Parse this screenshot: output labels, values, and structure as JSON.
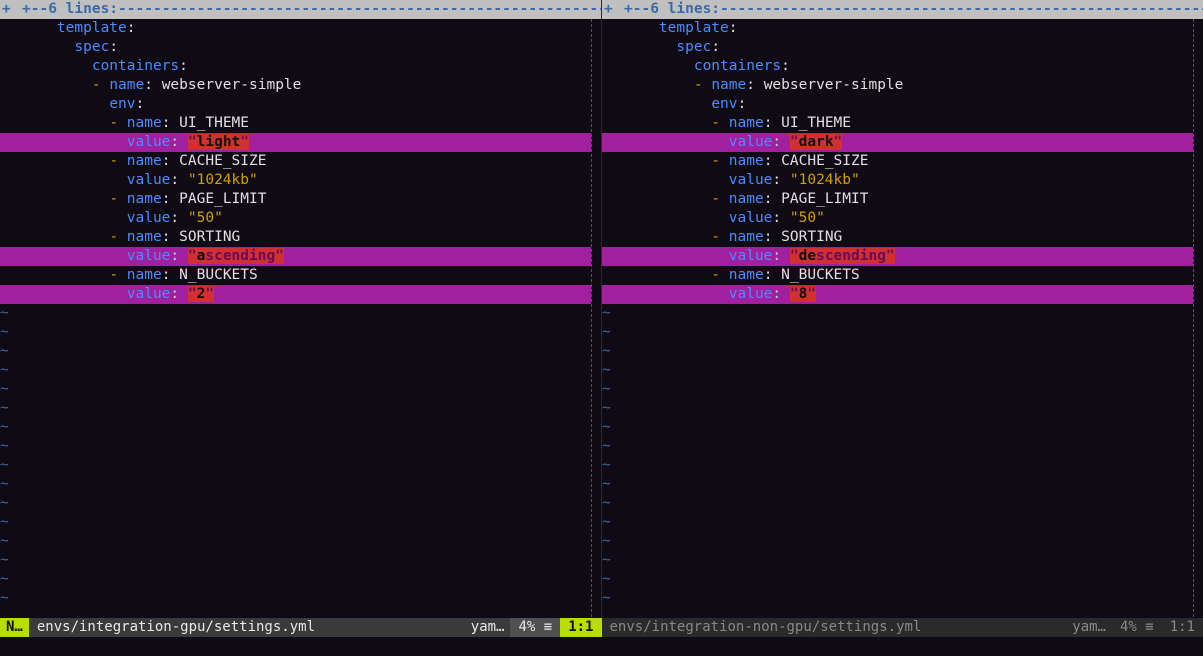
{
  "fold": {
    "marker_left": "+",
    "marker_plus": "+--",
    "count": "  6 lines:",
    "dashes": " -------------------------------------------------------------------------------------------------------------------"
  },
  "left": {
    "lines": {
      "l1": {
        "indent": "    ",
        "key": "template",
        "colon": ":"
      },
      "l2": {
        "indent": "      ",
        "key": "spec",
        "colon": ":"
      },
      "l3": {
        "indent": "        ",
        "key": "containers",
        "colon": ":"
      },
      "l4": {
        "indent": "        ",
        "dash": "- ",
        "key": "name",
        "colon": ": ",
        "val": "webserver-simple"
      },
      "l5": {
        "indent": "          ",
        "key": "env",
        "colon": ":"
      },
      "l6": {
        "indent": "          ",
        "dash": "- ",
        "key": "name",
        "colon": ": ",
        "val": "UI_THEME"
      },
      "l7": {
        "indent": "            ",
        "key": "value",
        "colon": ": ",
        "q1": "\"",
        "diff": "light",
        "q2": "\""
      },
      "l8": {
        "indent": "          ",
        "dash": "- ",
        "key": "name",
        "colon": ": ",
        "val": "CACHE_SIZE"
      },
      "l9": {
        "indent": "            ",
        "key": "value",
        "colon": ": ",
        "str": "\"1024kb\""
      },
      "l10": {
        "indent": "          ",
        "dash": "- ",
        "key": "name",
        "colon": ": ",
        "val": "PAGE_LIMIT"
      },
      "l11": {
        "indent": "            ",
        "key": "value",
        "colon": ": ",
        "str": "\"50\""
      },
      "l12": {
        "indent": "          ",
        "dash": "- ",
        "key": "name",
        "colon": ": ",
        "val": "SORTING"
      },
      "l13": {
        "indent": "            ",
        "key": "value",
        "colon": ": ",
        "q1": "\"",
        "diff1": "a",
        "rest": "scending\"",
        "diff2": ""
      },
      "l14": {
        "indent": "          ",
        "dash": "- ",
        "key": "name",
        "colon": ": ",
        "val": "N_BUCKETS"
      },
      "l15": {
        "indent": "            ",
        "key": "value",
        "colon": ": ",
        "q1": "\"",
        "diff": "2",
        "q2": "\""
      }
    },
    "status": {
      "mode": "N…",
      "file": "envs/integration-gpu/settings.yml",
      "ft": "yam…",
      "pct": "4% ≡",
      "pos": "1:1"
    }
  },
  "right": {
    "lines": {
      "l1": {
        "indent": "    ",
        "key": "template",
        "colon": ":"
      },
      "l2": {
        "indent": "      ",
        "key": "spec",
        "colon": ":"
      },
      "l3": {
        "indent": "        ",
        "key": "containers",
        "colon": ":"
      },
      "l4": {
        "indent": "        ",
        "dash": "- ",
        "key": "name",
        "colon": ": ",
        "val": "webserver-simple"
      },
      "l5": {
        "indent": "          ",
        "key": "env",
        "colon": ":"
      },
      "l6": {
        "indent": "          ",
        "dash": "- ",
        "key": "name",
        "colon": ": ",
        "val": "UI_THEME"
      },
      "l7": {
        "indent": "            ",
        "key": "value",
        "colon": ": ",
        "q1": "\"",
        "diff": "dark",
        "q2": "\""
      },
      "l8": {
        "indent": "          ",
        "dash": "- ",
        "key": "name",
        "colon": ": ",
        "val": "CACHE_SIZE"
      },
      "l9": {
        "indent": "            ",
        "key": "value",
        "colon": ": ",
        "str": "\"1024kb\""
      },
      "l10": {
        "indent": "          ",
        "dash": "- ",
        "key": "name",
        "colon": ": ",
        "val": "PAGE_LIMIT"
      },
      "l11": {
        "indent": "            ",
        "key": "value",
        "colon": ": ",
        "str": "\"50\""
      },
      "l12": {
        "indent": "          ",
        "dash": "- ",
        "key": "name",
        "colon": ": ",
        "val": "SORTING"
      },
      "l13": {
        "indent": "            ",
        "key": "value",
        "colon": ": ",
        "q1": "\"",
        "diff1": "de",
        "rest": "scending\"",
        "diff2": ""
      },
      "l14": {
        "indent": "          ",
        "dash": "- ",
        "key": "name",
        "colon": ": ",
        "val": "N_BUCKETS"
      },
      "l15": {
        "indent": "            ",
        "key": "value",
        "colon": ": ",
        "q1": "\"",
        "diff": "8",
        "q2": "\""
      }
    },
    "status": {
      "file": "envs/integration-non-gpu/settings.yml",
      "ft": "yam…",
      "pct": "4% ≡",
      "pos": "1:1"
    }
  },
  "tilde": "~",
  "cmd": " "
}
